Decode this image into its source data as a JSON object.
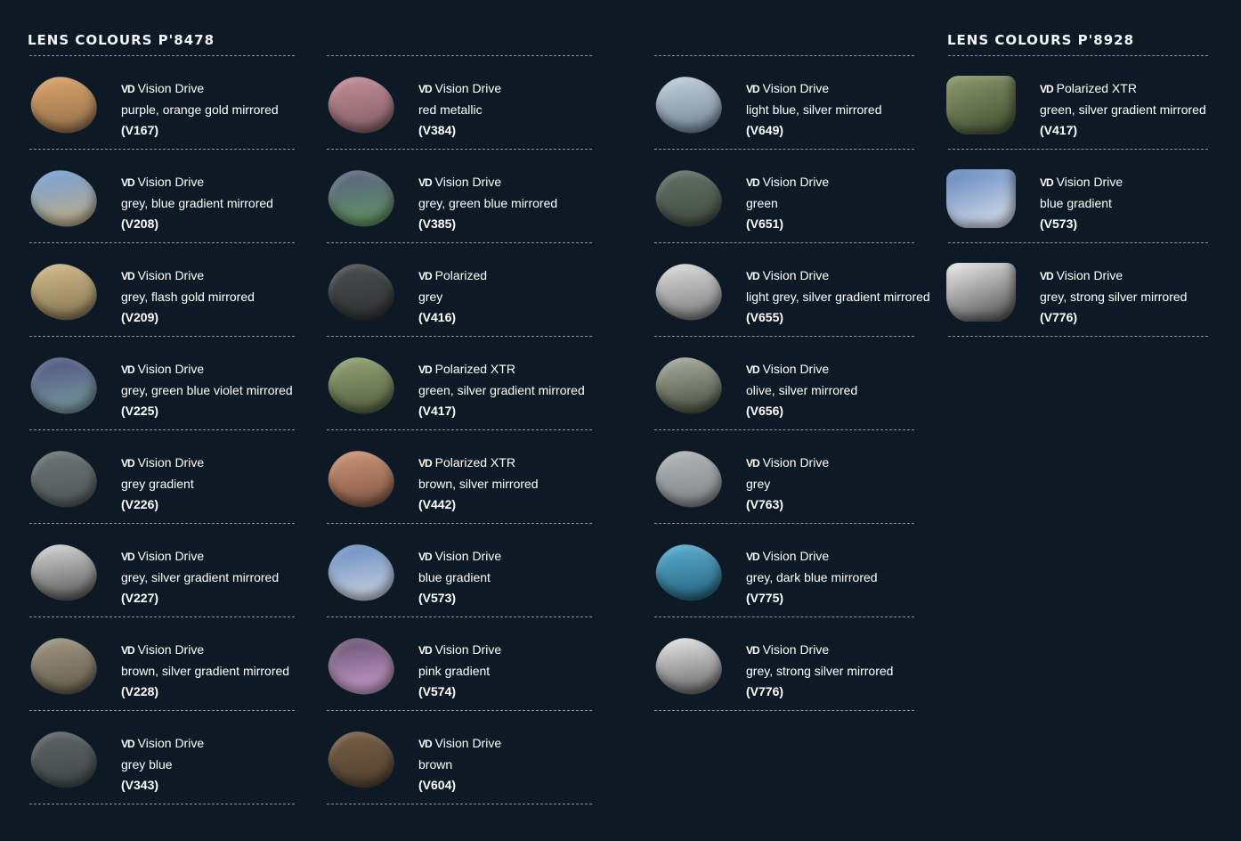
{
  "headings": {
    "p8478": "LENS COLOURS P'8478",
    "p8928": "LENS COLOURS P'8928"
  },
  "logo_text": "VD",
  "columns": [
    [
      {
        "brand": "Vision Drive",
        "desc": "purple, orange gold mirrored",
        "code": "(V167)",
        "color_a": "#e2a86a",
        "color_b": "#8a6a4a"
      },
      {
        "brand": "Vision Drive",
        "desc": "grey, blue gradient mirrored",
        "code": "(V208)",
        "color_a": "#6f9fe0",
        "color_b": "#c8b07a"
      },
      {
        "brand": "Vision Drive",
        "desc": "grey, flash gold mirrored",
        "code": "(V209)",
        "color_a": "#d8c090",
        "color_b": "#7e6f4c"
      },
      {
        "brand": "Vision Drive",
        "desc": "grey, green blue violet mirrored",
        "code": "(V225)",
        "color_a": "#4b4f7e",
        "color_b": "#7fa3a2"
      },
      {
        "brand": "Vision Drive",
        "desc": "grey gradient",
        "code": "(V226)",
        "color_a": "#6e7677",
        "color_b": "#4d5556"
      },
      {
        "brand": "Vision Drive",
        "desc": "grey, silver gradient mirrored",
        "code": "(V227)",
        "color_a": "#e0e0e0",
        "color_b": "#4a4a4a"
      },
      {
        "brand": "Vision Drive",
        "desc": "brown, silver gradient mirrored",
        "code": "(V228)",
        "color_a": "#a49a86",
        "color_b": "#5d5648"
      },
      {
        "brand": "Vision Drive",
        "desc": "grey blue",
        "code": "(V343)",
        "color_a": "#5f6667",
        "color_b": "#3f4546"
      }
    ],
    [
      {
        "brand": "Vision Drive",
        "desc": "red metallic",
        "code": "(V384)",
        "color_a": "#c8909a",
        "color_b": "#7e5a62"
      },
      {
        "brand": "Vision Drive",
        "desc": "grey, green blue mirrored",
        "code": "(V385)",
        "color_a": "#5b5d86",
        "color_b": "#5f9a5c"
      },
      {
        "brand": "Polarized",
        "desc": "grey",
        "code": "(V416)",
        "color_a": "#4e4f50",
        "color_b": "#2e2f30"
      },
      {
        "brand": "Polarized XTR",
        "desc": "green, silver gradient mirrored",
        "code": "(V417)",
        "color_a": "#98a878",
        "color_b": "#4d5a3a"
      },
      {
        "brand": "Polarized XTR",
        "desc": "brown, silver mirrored",
        "code": "(V442)",
        "color_a": "#d29a7a",
        "color_b": "#7a5040"
      },
      {
        "brand": "Vision Drive",
        "desc": "blue gradient",
        "code": "(V573)",
        "color_a": "#5f86c0",
        "color_b": "#d8dce4"
      },
      {
        "brand": "Vision Drive",
        "desc": "pink gradient",
        "code": "(V574)",
        "color_a": "#5c4a6a",
        "color_b": "#d8a8d6"
      },
      {
        "brand": "Vision Drive",
        "desc": "brown",
        "code": "(V604)",
        "color_a": "#7a6048",
        "color_b": "#4e3d2c"
      }
    ],
    [
      {
        "brand": "Vision Drive",
        "desc": "light blue, silver mirrored",
        "code": "(V649)",
        "color_a": "#c8d6e2",
        "color_b": "#6a7e8e"
      },
      {
        "brand": "Vision Drive",
        "desc": "green",
        "code": "(V651)",
        "color_a": "#667266",
        "color_b": "#3e4a40"
      },
      {
        "brand": "Vision Drive",
        "desc": "light grey, silver gradient mirrored",
        "code": "(V655)",
        "color_a": "#e4e4e4",
        "color_b": "#707070"
      },
      {
        "brand": "Vision Drive",
        "desc": "olive, silver mirrored",
        "code": "(V656)",
        "color_a": "#b0b4a4",
        "color_b": "#3e4436"
      },
      {
        "brand": "Vision Drive",
        "desc": "grey",
        "code": "(V763)",
        "color_a": "#b8bcbe",
        "color_b": "#7a7e80"
      },
      {
        "brand": "Vision Drive",
        "desc": "grey, dark blue mirrored",
        "code": "(V775)",
        "color_a": "#5fb4d8",
        "color_b": "#1f5a74"
      },
      {
        "brand": "Vision Drive",
        "desc": "grey, strong silver mirrored",
        "code": "(V776)",
        "color_a": "#f0f0f0",
        "color_b": "#5a5a5a"
      }
    ],
    [
      {
        "brand": "Polarized XTR",
        "desc": "green, silver gradient mirrored",
        "code": "(V417)",
        "color_a": "#8c9c6c",
        "color_b": "#3e4a30"
      },
      {
        "brand": "Vision Drive",
        "desc": "blue gradient",
        "code": "(V573)",
        "color_a": "#5f86c0",
        "color_b": "#e0e4ea"
      },
      {
        "brand": "Vision Drive",
        "desc": "grey, strong silver mirrored",
        "code": "(V776)",
        "color_a": "#eeeeee",
        "color_b": "#4a4a4a"
      }
    ]
  ]
}
